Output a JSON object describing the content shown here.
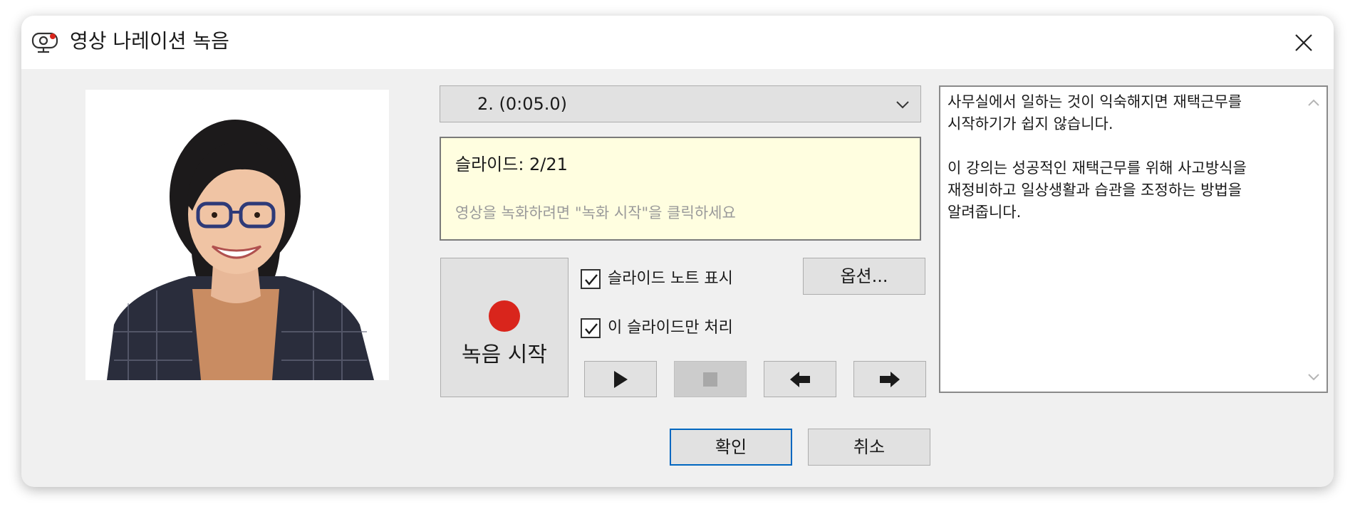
{
  "window": {
    "title": "영상 나레이션 녹음",
    "icon": "webcam-icon",
    "close_icon": "close-icon"
  },
  "segment_selector": {
    "selected": "2. (0:05.0)",
    "icon": "chevron-down-icon"
  },
  "info": {
    "slide_text": "슬라이드: 2/21",
    "hint": "영상을 녹화하려면 \"녹화 시작\"을 클릭하세요"
  },
  "record": {
    "label": "녹음 시작",
    "color": "#d9251c"
  },
  "options": {
    "show_notes_label": "슬라이드 노트 표시",
    "show_notes_checked": true,
    "only_this_slide_label": "이 슬라이드만 처리",
    "only_this_slide_checked": true,
    "options_button": "옵션..."
  },
  "playback": {
    "buttons": [
      {
        "name": "play",
        "icon": "play-icon",
        "enabled": true
      },
      {
        "name": "stop",
        "icon": "stop-icon",
        "enabled": false
      },
      {
        "name": "previous",
        "icon": "arrow-left-icon",
        "enabled": true
      },
      {
        "name": "next",
        "icon": "arrow-right-icon",
        "enabled": true
      }
    ]
  },
  "notes": {
    "text": "사무실에서 일하는 것이 익숙해지면 재택근무를 시작하기가 쉽지 않습니다.\n\n이 강의는 성공적인 재택근무를 위해 사고방식을 재정비하고 일상생활과 습관을 조정하는 방법을 알려줍니다."
  },
  "footer": {
    "ok": "확인",
    "cancel": "취소"
  },
  "colors": {
    "dialog_bg": "#f0f0f0",
    "info_bg": "#fffee0",
    "accent": "#0067c0",
    "record_red": "#d9251c"
  }
}
